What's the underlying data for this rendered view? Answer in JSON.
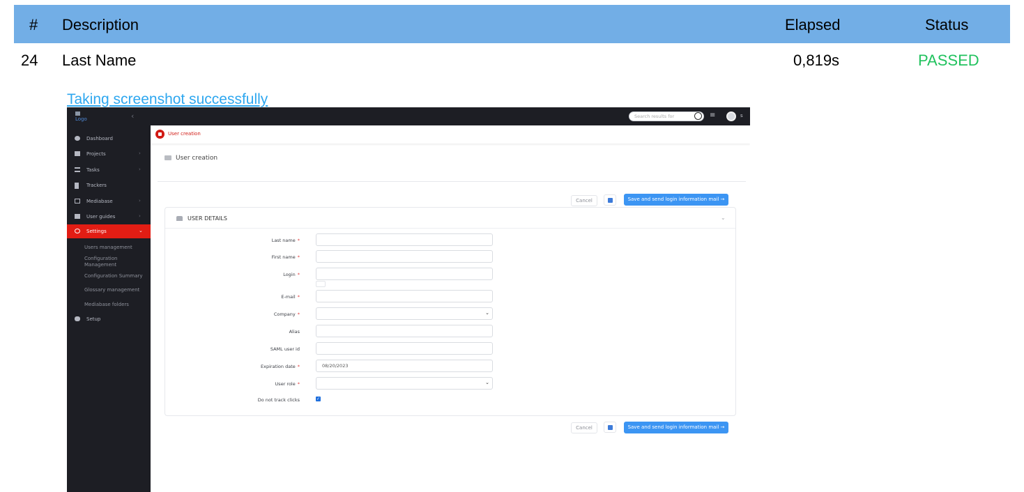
{
  "report": {
    "headers": {
      "num": "#",
      "description": "Description",
      "elapsed": "Elapsed",
      "status": "Status"
    },
    "row": {
      "num": "24",
      "description": "Last Name",
      "elapsed": "0,819s",
      "status": "PASSED"
    },
    "screenshot_link": "Taking screenshot successfully"
  },
  "app": {
    "logo_text": "Logo",
    "search_placeholder": "Search results for",
    "user_initial": "s",
    "sidebar": {
      "items": [
        {
          "label": "Dashboard"
        },
        {
          "label": "Projects"
        },
        {
          "label": "Tasks"
        },
        {
          "label": "Trackers"
        },
        {
          "label": "Mediabase"
        },
        {
          "label": "User guides"
        },
        {
          "label": "Settings"
        },
        {
          "label": "Setup"
        }
      ],
      "sub_items": [
        {
          "label": "Users management"
        },
        {
          "label": "Configuration Management"
        },
        {
          "label": "Configuration Summary"
        },
        {
          "label": "Glossary management"
        },
        {
          "label": "Mediabase folders"
        }
      ]
    },
    "tab_label": "User creation",
    "page_title": "User creation",
    "buttons": {
      "cancel": "Cancel",
      "save_send": "Save and send login information mail →"
    },
    "card_title": "USER DETAILS",
    "form": {
      "last_name": {
        "label": "Last name",
        "value": ""
      },
      "first_name": {
        "label": "First name",
        "value": ""
      },
      "login": {
        "label": "Login",
        "value": ""
      },
      "email": {
        "label": "E-mail",
        "value": ""
      },
      "company": {
        "label": "Company",
        "value": ""
      },
      "alias": {
        "label": "Alias",
        "value": ""
      },
      "saml": {
        "label": "SAML user id",
        "value": ""
      },
      "expiration": {
        "label": "Expiration date",
        "value": "08/20/2023"
      },
      "user_role": {
        "label": "User role",
        "value": ""
      },
      "no_track": {
        "label": "Do not track clicks",
        "checked": true
      }
    },
    "colors": {
      "accent": "#e21d14",
      "primary": "#3c95f3",
      "sidebar_bg": "#1d1e24",
      "passed": "#21c25e",
      "header_bg": "#72aee6"
    }
  }
}
